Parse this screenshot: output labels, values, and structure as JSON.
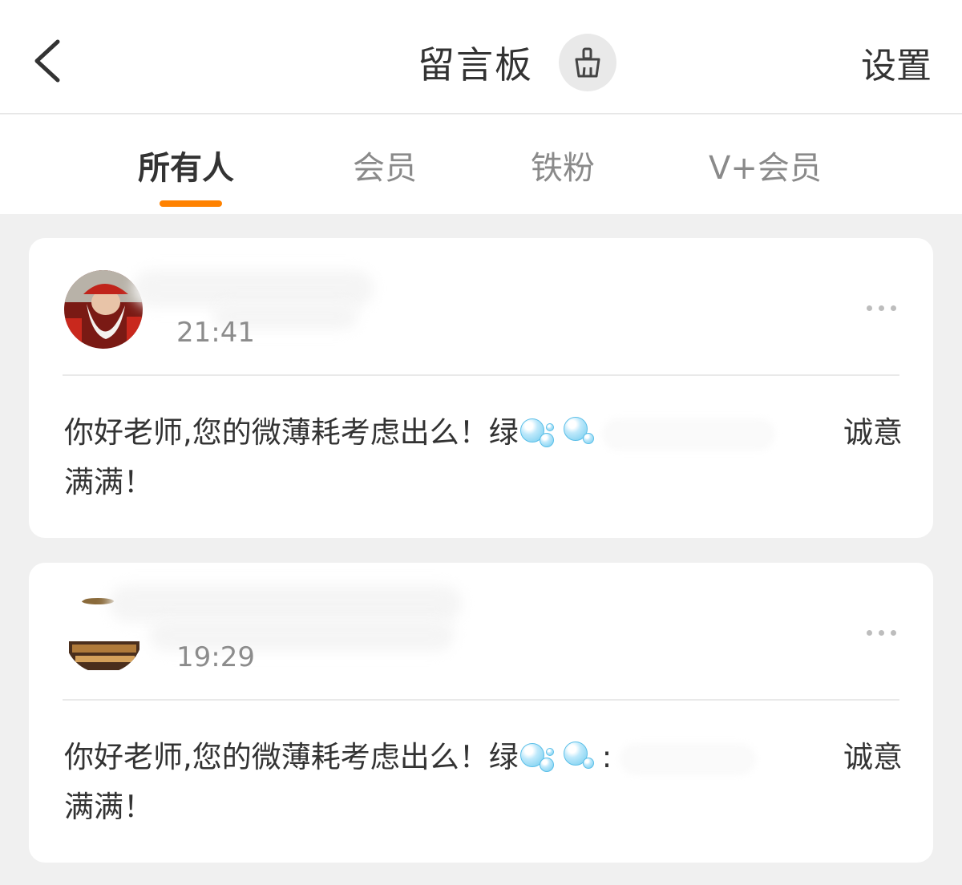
{
  "header": {
    "back_icon": "chevron-left-icon",
    "title": "留言板",
    "clean_icon": "broom-icon",
    "settings_label": "设置"
  },
  "tabs": [
    {
      "label": "所有人",
      "active": true
    },
    {
      "label": "会员",
      "active": false
    },
    {
      "label": "铁粉",
      "active": false
    },
    {
      "label": "V+会员",
      "active": false
    }
  ],
  "accent_color": "#ff8200",
  "messages": [
    {
      "time": "21:41",
      "text_before": "你好老师,您的微薄耗考虑出么！绿",
      "text_after_1": "诚意",
      "text_after_2": "满满！"
    },
    {
      "time": "19:29",
      "text_before": "你好老师,您的微薄耗考虑出么！绿",
      "text_colon": ":",
      "text_after_1": "诚意",
      "text_after_2": "满满！"
    }
  ]
}
